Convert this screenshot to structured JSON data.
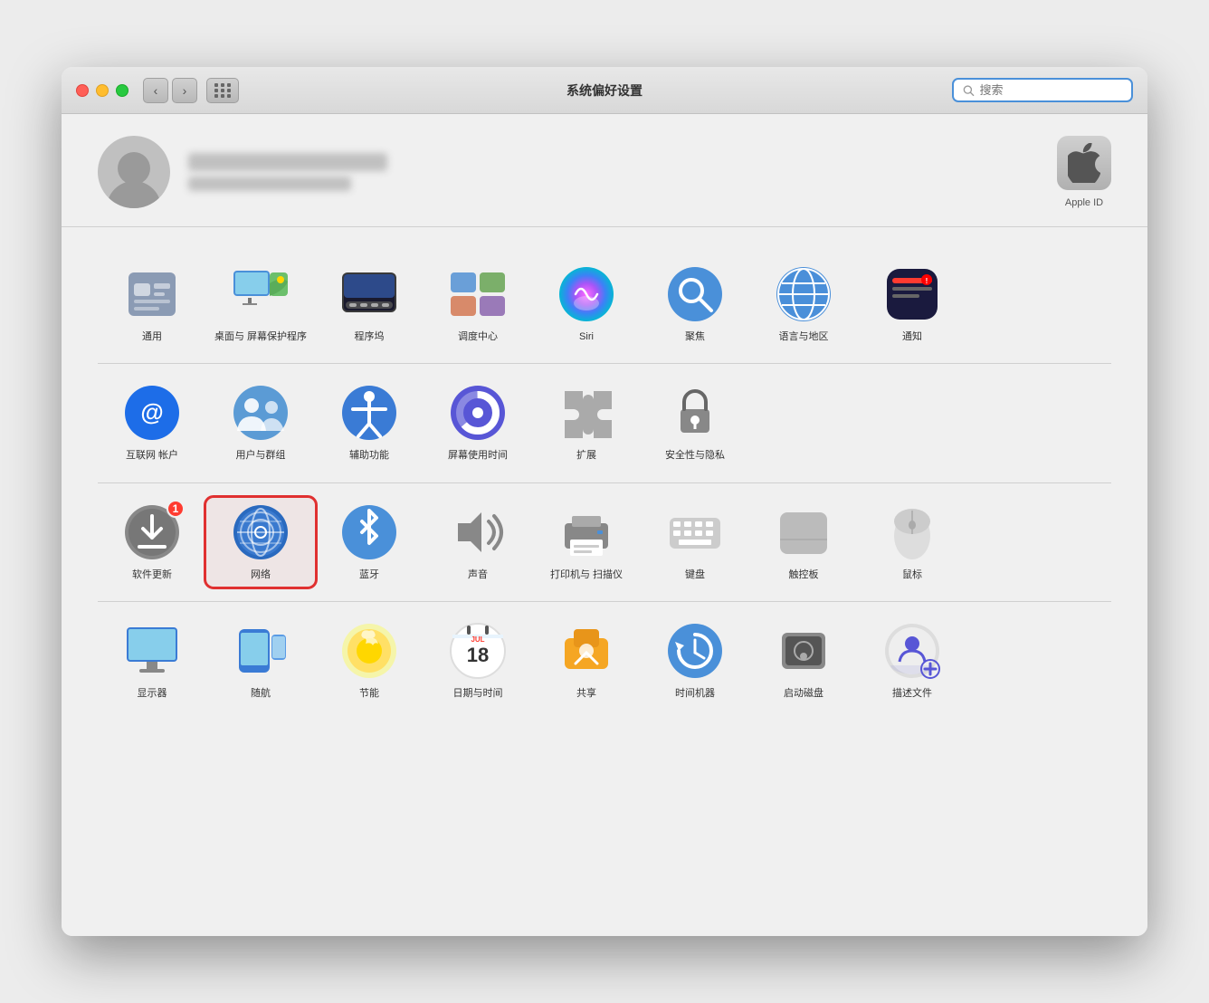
{
  "window": {
    "title": "系统偏好设置",
    "search_placeholder": "搜索"
  },
  "profile": {
    "apple_id_label": "Apple ID"
  },
  "rows": [
    {
      "items": [
        {
          "id": "general",
          "label": "通用",
          "icon": "general"
        },
        {
          "id": "desktop",
          "label": "桌面与\n屏幕保护程序",
          "icon": "desktop"
        },
        {
          "id": "dock",
          "label": "程序坞",
          "icon": "dock"
        },
        {
          "id": "mission",
          "label": "调度中心",
          "icon": "mission"
        },
        {
          "id": "siri",
          "label": "Siri",
          "icon": "siri"
        },
        {
          "id": "spotlight",
          "label": "聚焦",
          "icon": "spotlight"
        },
        {
          "id": "language",
          "label": "语言与地区",
          "icon": "language"
        },
        {
          "id": "notifications",
          "label": "通知",
          "icon": "notifications"
        }
      ]
    },
    {
      "items": [
        {
          "id": "internet",
          "label": "互联网\n帐户",
          "icon": "internet"
        },
        {
          "id": "users",
          "label": "用户与群组",
          "icon": "users"
        },
        {
          "id": "accessibility",
          "label": "辅助功能",
          "icon": "accessibility"
        },
        {
          "id": "screentime",
          "label": "屏幕使用时间",
          "icon": "screentime"
        },
        {
          "id": "extensions",
          "label": "扩展",
          "icon": "extensions"
        },
        {
          "id": "security",
          "label": "安全性与隐私",
          "icon": "security"
        }
      ]
    },
    {
      "items": [
        {
          "id": "softwareupdate",
          "label": "软件更新",
          "icon": "softwareupdate",
          "badge": "1"
        },
        {
          "id": "network",
          "label": "网络",
          "icon": "network",
          "selected": true
        },
        {
          "id": "bluetooth",
          "label": "蓝牙",
          "icon": "bluetooth"
        },
        {
          "id": "sound",
          "label": "声音",
          "icon": "sound"
        },
        {
          "id": "printers",
          "label": "打印机与\n扫描仪",
          "icon": "printers"
        },
        {
          "id": "keyboard",
          "label": "键盘",
          "icon": "keyboard"
        },
        {
          "id": "trackpad",
          "label": "触控板",
          "icon": "trackpad"
        },
        {
          "id": "mouse",
          "label": "鼠标",
          "icon": "mouse"
        }
      ]
    },
    {
      "items": [
        {
          "id": "displays",
          "label": "显示器",
          "icon": "displays"
        },
        {
          "id": "sidecar",
          "label": "随航",
          "icon": "sidecar"
        },
        {
          "id": "energy",
          "label": "节能",
          "icon": "energy"
        },
        {
          "id": "datetime",
          "label": "日期与时间",
          "icon": "datetime"
        },
        {
          "id": "sharing",
          "label": "共享",
          "icon": "sharing"
        },
        {
          "id": "timemachine",
          "label": "时间机器",
          "icon": "timemachine"
        },
        {
          "id": "startup",
          "label": "启动磁盘",
          "icon": "startup"
        },
        {
          "id": "profiles",
          "label": "描述文件",
          "icon": "profiles"
        }
      ]
    }
  ]
}
